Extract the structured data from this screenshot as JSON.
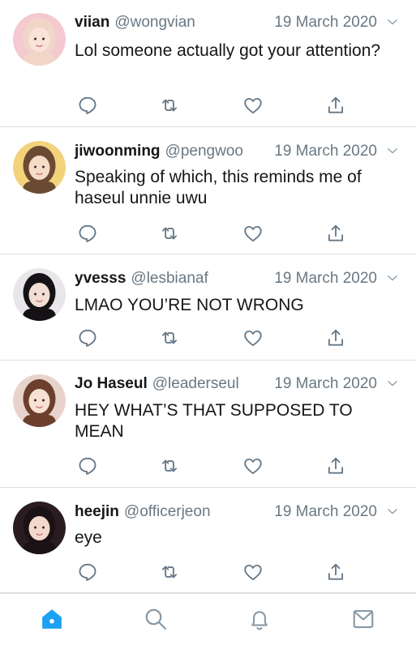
{
  "tweets": [
    {
      "name": "viian",
      "handle": "@wongvian",
      "date": "19 March 2020",
      "text": "Lol someone actually got your attention?",
      "avatar": {
        "bg": "#f4c9cf",
        "hair": "#f1d6c8",
        "skin": "#fbe3da",
        "label": "pink-haired-portrait"
      }
    },
    {
      "name": "jiwoonming",
      "handle": "@pengwoo",
      "date": "19 March 2020",
      "text": "Speaking of which, this reminds me of haseul unnie uwu",
      "avatar": {
        "bg": "#f2d27b",
        "hair": "#6a4a32",
        "skin": "#f6dcc8",
        "label": "smiling-portrait-bear-ears"
      }
    },
    {
      "name": "yvesss",
      "handle": "@lesbianaf",
      "date": "19 March 2020",
      "text": "LMAO YOU’RE NOT WRONG",
      "avatar": {
        "bg": "#e9e6ea",
        "hair": "#141214",
        "skin": "#f1ddd4",
        "label": "black-haired-portrait"
      }
    },
    {
      "name": "Jo Haseul",
      "handle": "@leaderseul",
      "date": "19 March 2020",
      "text": "HEY WHAT’S THAT SUPPOSED TO MEAN",
      "avatar": {
        "bg": "#e8d3cc",
        "hair": "#6b3f2c",
        "skin": "#f7e0d4",
        "label": "brown-haired-portrait"
      }
    },
    {
      "name": "heejin",
      "handle": "@officerjeon",
      "date": "19 March 2020",
      "text": "eye",
      "avatar": {
        "bg": "#2a1c20",
        "hair": "#1a1214",
        "skin": "#f3d8cc",
        "label": "smiling-portrait-dark"
      }
    }
  ],
  "actions": [
    "reply-icon",
    "retweet-icon",
    "like-icon",
    "share-icon"
  ],
  "nav": [
    "home-icon",
    "search-icon",
    "notifications-icon",
    "messages-icon"
  ],
  "colors": {
    "accent": "#1da1f2",
    "icon_gray": "#657786",
    "text": "#14171a",
    "muted": "#697882",
    "divider": "#d9dde1"
  }
}
